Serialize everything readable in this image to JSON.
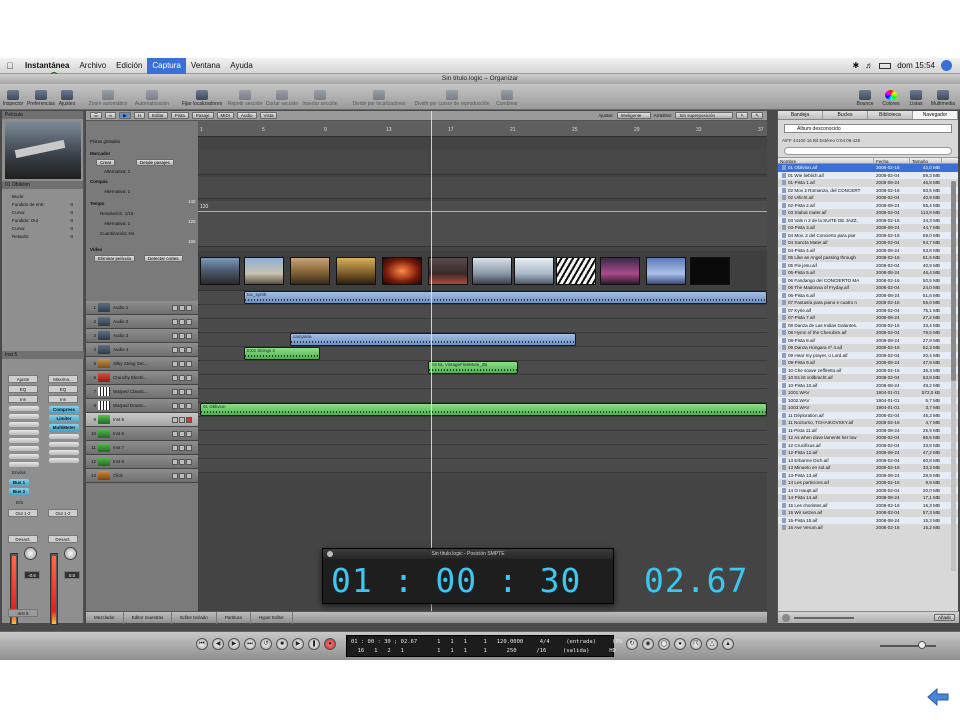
{
  "menubar": {
    "app_name": "Instantánea",
    "items": [
      "Archivo",
      "Edición",
      "Captura",
      "Ventana",
      "Ayuda"
    ],
    "active_item": "Captura",
    "clock": "dom 15:54"
  },
  "window": {
    "title": "Sin título.logic – Organizar"
  },
  "toolbar": {
    "buttons": [
      {
        "label": "Inspector",
        "state": "on"
      },
      {
        "label": "Preferencias",
        "state": "on"
      },
      {
        "label": "Ajustes",
        "state": "on"
      },
      {
        "label": "Zoom automático",
        "state": "dim"
      },
      {
        "label": "Automatización",
        "state": "dim"
      },
      {
        "label": "Fijar localizadores",
        "state": "on"
      },
      {
        "label": "Repetir sección",
        "state": "dim"
      },
      {
        "label": "Cortar sección",
        "state": "dim"
      },
      {
        "label": "Insertar sección",
        "state": "dim"
      },
      {
        "label": "Dividir por localizadores",
        "state": "dim"
      },
      {
        "label": "Dividir por cursor de reproducción",
        "state": "dim"
      },
      {
        "label": "Combinar",
        "state": "dim"
      }
    ],
    "right_buttons": [
      "Bounce",
      "Colores",
      "Listas",
      "Multimedia"
    ]
  },
  "inspector": {
    "section_title": "Película",
    "region_title": "01 Oblivion",
    "params": [
      {
        "label": "Bucle:",
        "value": ""
      },
      {
        "label": "Fundido de entr:",
        "value": "0"
      },
      {
        "label": "Curva:",
        "value": "0"
      },
      {
        "label": "Fundido: Out",
        "value": "0"
      },
      {
        "label": "Curva:",
        "value": "0"
      },
      {
        "label": "Retardo:",
        "value": "0"
      }
    ],
    "track_title": "Inst 5",
    "left_strip": {
      "setting": "Ajuste",
      "eq": "EQ",
      "ins": "Ins",
      "sends": "Envíos",
      "bus1": "Bus 1",
      "bus2": "Bus 2",
      "io": "E/S",
      "out": "Out 1-2",
      "name": "Inst 5",
      "automation": "Desact.",
      "value": "-0.6",
      "bottom": "M",
      "bottom2": "S",
      "bottom3": "Inst 5"
    },
    "right_strip": {
      "setting": "Maxima...",
      "eq": "EQ",
      "ins": "Ins",
      "plugins": [
        "Compress",
        "Limiter",
        "MultiMeter"
      ],
      "out": "Out 1-2",
      "automation": "Desact.",
      "value": "0.0",
      "bottom": "M",
      "bottom2": "Bnce"
    }
  },
  "arrange": {
    "menus": [
      "Editar",
      "Pista",
      "Pasaje",
      "MIDI",
      "Audio",
      "Vista"
    ],
    "snap_label": "Ajustar:",
    "snap_value": "Inteligente",
    "drag_label": "Arrastrar:",
    "drag_value": "Sin superposición",
    "ruler_marks": [
      "1",
      "5",
      "9",
      "13",
      "17",
      "21",
      "25",
      "29",
      "33",
      "37"
    ],
    "global": {
      "header": "Pistas globales",
      "marker": "Marcador",
      "create": "Crear",
      "from_regions": "Desde pasajes",
      "alternative": "Alternativa: 1",
      "compas": "Compás",
      "compas_alt": "Alternativa: 1",
      "tempo": "Tempo",
      "resolution": "Resolución: 1/16",
      "tempo_alt": "Alternativa: 1",
      "quantize": "Cuantización: No",
      "tempo_value": "120",
      "tempo_scale": [
        "140",
        "120",
        "100"
      ],
      "video": "Vídeo",
      "remove_movie": "Eliminar película",
      "detect_cuts": "Detectar cortes"
    },
    "tracks": [
      {
        "num": "1",
        "name": "Audio 1"
      },
      {
        "num": "2",
        "name": "Audio 2"
      },
      {
        "num": "3",
        "name": "Audio 3"
      },
      {
        "num": "4",
        "name": "Audio 4"
      },
      {
        "num": "5",
        "name": "Silky String Sec..."
      },
      {
        "num": "6",
        "name": "Crunchy Electri..."
      },
      {
        "num": "7",
        "name": "Warped Classic..."
      },
      {
        "num": "8",
        "name": "Warped Downt..."
      },
      {
        "num": "9",
        "name": "Inst 5"
      },
      {
        "num": "10",
        "name": "Inst 6"
      },
      {
        "num": "11",
        "name": "Inst 7"
      },
      {
        "num": "12",
        "name": "Inst 8"
      },
      {
        "num": "13",
        "name": "Click"
      }
    ],
    "regions": {
      "audio1": "toc_synth",
      "audio4": "campana",
      "silky": "EXS Strings 2",
      "crunchy": "ES EL VintageFlickMute_2B",
      "inst5": "01 Oblivion"
    },
    "bottom_tabs": [
      "Mezclador",
      "Editor muestras",
      "Editor teclado",
      "Partitura",
      "Hyper Editor"
    ]
  },
  "browser": {
    "tabs": [
      "Bandeja",
      "Bucles",
      "Biblioteca",
      "Navegador"
    ],
    "active_tab": "Navegador",
    "album": "Álbum desconocido",
    "info": "AIFF   44100   16 Bit   Estéreo   0:04:09.428",
    "columns": [
      "Nombre",
      "Fecha",
      "Tamaño"
    ],
    "files": [
      [
        "01 Oblivion.aif",
        "2008-02-16",
        "42,0 MB"
      ],
      [
        "01 Wie lieblich.aif",
        "2008-02-04",
        "59,3 MB"
      ],
      [
        "01-Pista 1.aif",
        "2008-08-24",
        "46,8 MB"
      ],
      [
        "02 Mov 2 Romanza, del CONCERT",
        "2008-02-16",
        "50,5 MB"
      ],
      [
        "02 Urlicht.aif",
        "2008-02-04",
        "40,9 MB"
      ],
      [
        "02-Pista 2.aif",
        "2008-08-24",
        "55,4 MB"
      ],
      [
        "03 Stabat mater.aif",
        "2008-02-04",
        "113,8 MB"
      ],
      [
        "03 Vals n 2 de la SUITE DE JAZZ,",
        "2008-02-16",
        "34,3 MB"
      ],
      [
        "03-Pista 3.aif",
        "2008-08-24",
        "44,7 MB"
      ],
      [
        "04 Mov. 2 del Concierto para piar",
        "2008-02-16",
        "59,0 MB"
      ],
      [
        "04 Sancta Mater.aif",
        "2008-02-04",
        "54,7 MB"
      ],
      [
        "04-Pista 4.aif",
        "2008-08-24",
        "53,8 MB"
      ],
      [
        "05 Like an Angel passing through",
        "2008-02-16",
        "51,6 MB"
      ],
      [
        "05 Pie jesu.aif",
        "2008-02-04",
        "40,9 MB"
      ],
      [
        "05-Pista 5.aif",
        "2008-08-24",
        "46,4 MB"
      ],
      [
        "06 Fandango del CONCIERTO MA",
        "2008-02-16",
        "50,5 MB"
      ],
      [
        "06 The Madonna of Fryday.aif",
        "2008-02-04",
        "24,0 MB"
      ],
      [
        "06-Pista 6.aif",
        "2008-08-24",
        "51,6 MB"
      ],
      [
        "07 Fantasía para piano e cuatro n",
        "2008-02-16",
        "55,0 MB"
      ],
      [
        "07 Kyrie.aif",
        "2008-02-04",
        "75,1 MB"
      ],
      [
        "07-Pista 7.aif",
        "2008-08-24",
        "27,2 MB"
      ],
      [
        "08 Danza de Las Indias Galantes.",
        "2008-02-16",
        "33,4 MB"
      ],
      [
        "08 Hymn of the Cherubim.aif",
        "2008-02-04",
        "79,5 MB"
      ],
      [
        "08-Pista 8.aif",
        "2008-08-24",
        "27,9 MB"
      ],
      [
        "09 Danza Húngara nº 4.aif",
        "2008-02-16",
        "52,3 MB"
      ],
      [
        "09 Hear my prayer, o Lord.aif",
        "2008-02-04",
        "20,4 MB"
      ],
      [
        "09-Pista 9.aif",
        "2008-08-24",
        "47,9 MB"
      ],
      [
        "10 Che soave zeffiretto.aif",
        "2008-02-16",
        "36,3 MB"
      ],
      [
        "10 Es ist vollbracht.aif",
        "2008-02-04",
        "53,8 MB"
      ],
      [
        "10-Pista 10.aif",
        "2008-08-24",
        "48,2 MB"
      ],
      [
        "1001.WAV",
        "1904-01-01",
        "572,0 kB"
      ],
      [
        "1002.WAV",
        "1904-01-01",
        "5,7 MB"
      ],
      [
        "1003.WAV",
        "1904-01-01",
        "3,7 MB"
      ],
      [
        "11 Déploration.aif",
        "2008-02-04",
        "46,3 MB"
      ],
      [
        "11 Nocturno, TCHAIKOVSKY.aif",
        "2008-02-16",
        "4,7 MB"
      ],
      [
        "11-Pista 11.aif",
        "2008-08-24",
        "25,9 MB"
      ],
      [
        "12 As when dove laments her low",
        "2008-02-04",
        "86,5 MB"
      ],
      [
        "12 Crucifixus.aif",
        "2008-02-04",
        "33,8 MB"
      ],
      [
        "12-Pista 12.aif",
        "2008-08-24",
        "47,2 MB"
      ],
      [
        "13 Erbarme Dich.aif",
        "2008-02-04",
        "60,8 MB"
      ],
      [
        "13 Minueto en sol.aif",
        "2008-02-16",
        "33,3 MB"
      ],
      [
        "13-Pista 13.aif",
        "2008-08-24",
        "28,9 MB"
      ],
      [
        "14 Les particions.aif",
        "2008-02-16",
        "9,9 MB"
      ],
      [
        "14 O Haupt.aif",
        "2008-02-04",
        "20,0 MB"
      ],
      [
        "14-Pista 14.aif",
        "2008-08-24",
        "17,1 MB"
      ],
      [
        "15 Les choristes.aif",
        "2008-02-16",
        "15,3 MB"
      ],
      [
        "15 Wir setzen.aif",
        "2008-02-04",
        "57,3 MB"
      ],
      [
        "15-Pista 15.aif",
        "2008-08-24",
        "15,3 MB"
      ],
      [
        "16 Ave Verum.aif",
        "2008-02-16",
        "15,2 MB"
      ]
    ],
    "add_button": "Añadir"
  },
  "transport": {
    "lcd_line1": "01 : 00 : 30 ; 02.67      1   1   1     1   120.0000     4/4     (entrada)     CPU",
    "lcd_line2": "  16   1   2   1          1   1   1     1      250      /16     (salida)      HD"
  },
  "smpte": {
    "title": "Sin título.logic - Posición SMPTE",
    "time": "01 : 00 : 30   02.67"
  },
  "colors": {
    "audio_region": "#8aa6d4",
    "midi_region": "#5cc257",
    "smpte_digits": "#3cc7f0",
    "menu_highlight": "#3a6fd8"
  }
}
